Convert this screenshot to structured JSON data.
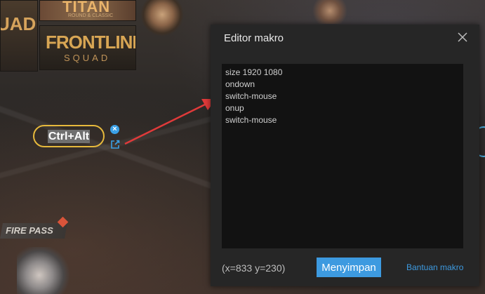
{
  "background": {
    "tiles": {
      "squad_left": "UAD",
      "titan": "TITAN",
      "titan_sub": "ROUND & CLASSIC",
      "frontline": "FRONTLINE",
      "frontline_sub": "SQUAD"
    },
    "fire_pass": "FIRE PASS"
  },
  "macro_key": {
    "label": "Ctrl+Alt",
    "border_color": "#e6b93c"
  },
  "icons": {
    "delete": "close-circle-icon",
    "edit": "edit-external-icon",
    "close": "close-icon"
  },
  "dialog": {
    "title": "Editor makro",
    "script_text": "size 1920 1080\nondown\nswitch-mouse\nonup\nswitch-mouse",
    "coordinates": "(x=833  y=230)",
    "save_label": "Menyimpan",
    "help_label": "Bantuan makro",
    "accent_color": "#3d9ae0"
  },
  "annotation_arrow_color": "#e03a3a"
}
